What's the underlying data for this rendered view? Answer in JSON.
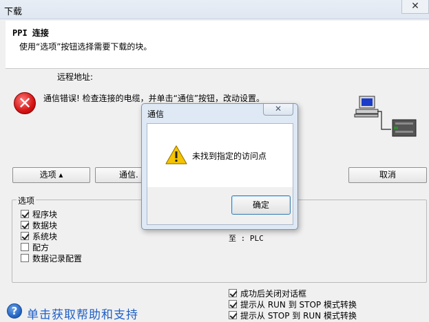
{
  "window": {
    "title": "下载",
    "close_label": "✕"
  },
  "header": {
    "title": "PPI 连接",
    "description": "使用“选项”按钮选择需要下载的块。"
  },
  "remote": {
    "label": "远程地址:"
  },
  "error": {
    "icon": "error-icon",
    "message": "通信错误!  检查连接的电缆，并单击“通信”按钮，改动设置。"
  },
  "buttons": {
    "options": "选项 ▴",
    "communication": "通信.",
    "cancel": "取消"
  },
  "options": {
    "legend": "选项",
    "items": [
      {
        "label": "程序块",
        "checked": true
      },
      {
        "label": "数据块",
        "checked": true
      },
      {
        "label": "系统块",
        "checked": true
      },
      {
        "label": "配方",
        "checked": false
      },
      {
        "label": "数据记录配置",
        "checked": false
      }
    ],
    "to_plc": "至 : PLC"
  },
  "post_options": [
    {
      "label": "成功后关闭对话框",
      "checked": true
    },
    {
      "label": "提示从 RUN 到 STOP 模式转换",
      "checked": true
    },
    {
      "label": "提示从 STOP 到 RUN 模式转换",
      "checked": true
    }
  ],
  "help": {
    "icon": "help-icon",
    "glyph": "?",
    "text": "单击获取帮助和支持"
  },
  "dialog": {
    "title": "通信",
    "close_label": "✕",
    "message": "未找到指定的访问点",
    "ok_label": "确定",
    "icon": "warning-icon"
  }
}
